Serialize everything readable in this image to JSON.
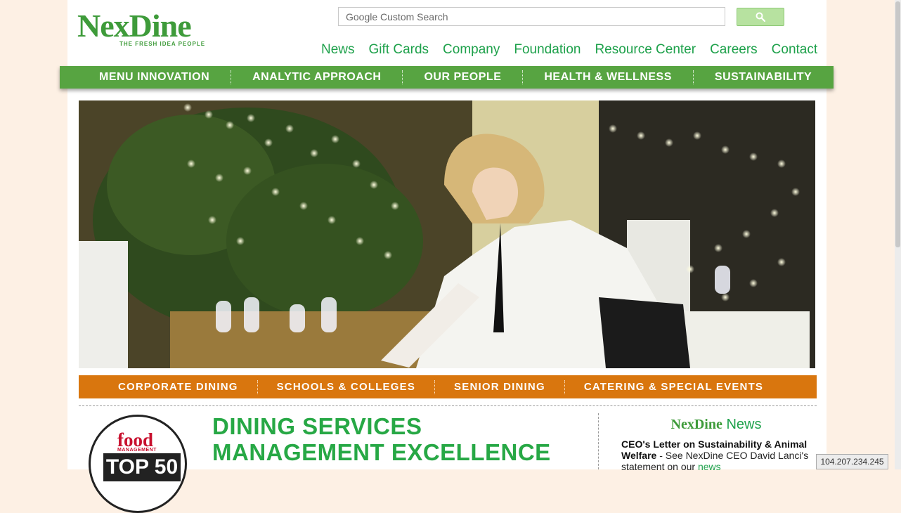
{
  "brand": {
    "name": "NexDine",
    "tagline": "THE FRESH IDEA PEOPLE"
  },
  "search": {
    "placeholder": "Google Custom Search",
    "value": ""
  },
  "top_links": [
    "News",
    "Gift Cards",
    "Company",
    "Foundation",
    "Resource Center",
    "Careers",
    "Contact"
  ],
  "main_nav": [
    "MENU INNOVATION",
    "ANALYTIC APPROACH",
    "OUR PEOPLE",
    "HEALTH & WELLNESS",
    "SUSTAINABILITY"
  ],
  "sub_nav": [
    "CORPORATE DINING",
    "SCHOOLS & COLLEGES",
    "SENIOR DINING",
    "CATERING & SPECIAL EVENTS"
  ],
  "badge": {
    "word1": "food",
    "word2": "MANAGEMENT",
    "word3": "TOP 50"
  },
  "headline": {
    "line1": "DINING SERVICES",
    "line2": "MANAGEMENT EXCELLENCE"
  },
  "news": {
    "brand": "NexDine",
    "title": "News",
    "item_bold": "CEO's Letter on Sustainability & Animal Welfare",
    "item_text": " - See NexDine CEO David Lanci's statement on our ",
    "item_link": "news"
  },
  "ip_badge": "104.207.234.245",
  "colors": {
    "green": "#57a441",
    "orange": "#d9760e",
    "link_green": "#1ea14b",
    "peach": "#fdf0e4"
  }
}
